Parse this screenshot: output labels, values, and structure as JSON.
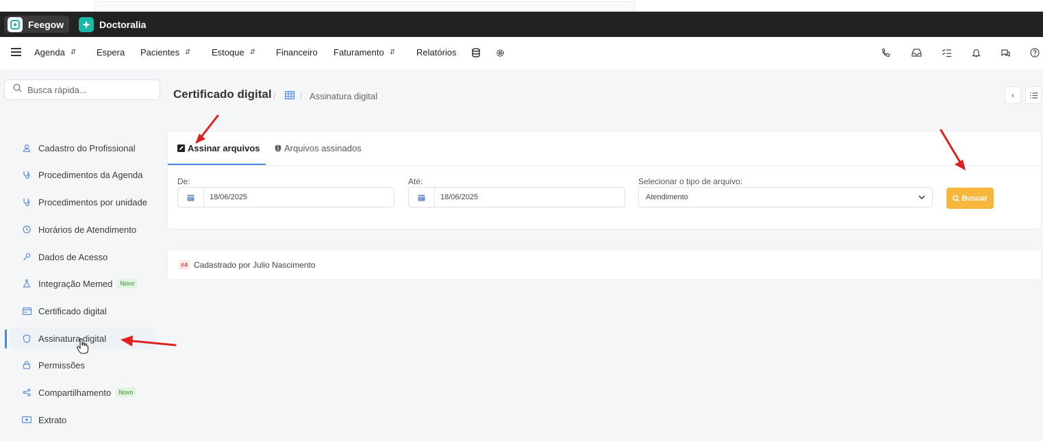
{
  "brands": {
    "feegow": "Feegow",
    "doctoralia": "Doctoralia"
  },
  "topnav": {
    "items": [
      {
        "label": "Agenda",
        "dropdown": true
      },
      {
        "label": "Espera",
        "dropdown": false
      },
      {
        "label": "Pacientes",
        "dropdown": true
      },
      {
        "label": "Estoque",
        "dropdown": true
      },
      {
        "label": "Financeiro",
        "dropdown": false
      },
      {
        "label": "Faturamento",
        "dropdown": true
      },
      {
        "label": "Relatórios",
        "dropdown": false
      }
    ],
    "right_icons": [
      "phone-icon",
      "inbox-icon",
      "checklist-icon",
      "bell-icon",
      "chat-icon",
      "help-icon"
    ]
  },
  "sidebar": {
    "search_placeholder": "Busca rápida...",
    "items": [
      {
        "label": "Cadastro do Profissional",
        "icon": "user-icon"
      },
      {
        "label": "Procedimentos da Agenda",
        "icon": "stethoscope-icon"
      },
      {
        "label": "Procedimentos por unidade",
        "icon": "stethoscope-icon"
      },
      {
        "label": "Horários de Atendimento",
        "icon": "clock-icon"
      },
      {
        "label": "Dados de Acesso",
        "icon": "key-icon"
      },
      {
        "label": "Integração Memed",
        "icon": "flask-icon",
        "badge": "Novo"
      },
      {
        "label": "Certificado digital",
        "icon": "card-icon"
      },
      {
        "label": "Assinatura digital",
        "icon": "shield-icon",
        "active": true
      },
      {
        "label": "Permissões",
        "icon": "lock-icon"
      },
      {
        "label": "Compartilhamento",
        "icon": "share-icon",
        "badge": "Novo"
      },
      {
        "label": "Extrato",
        "icon": "money-icon"
      }
    ]
  },
  "header": {
    "title": "Certificado digital",
    "breadcrumb": "Assinatura digital"
  },
  "tabs": [
    {
      "label": "Assinar arquivos",
      "active": true
    },
    {
      "label": "Arquivos assinados",
      "active": false
    }
  ],
  "form": {
    "from_label": "De:",
    "from_value": "18/06/2025",
    "to_label": "Até:",
    "to_value": "18/06/2025",
    "type_label": "Selecionar o tipo de arquivo:",
    "type_value": "Atendimento",
    "search_button": "Buscar"
  },
  "result": {
    "badge": "#4",
    "text": "Cadastrado por Julio Nascimento"
  },
  "colors": {
    "accent": "#4a86e8",
    "button": "#f6b73c",
    "annotation": "#e02020",
    "darkbar": "#222222"
  }
}
